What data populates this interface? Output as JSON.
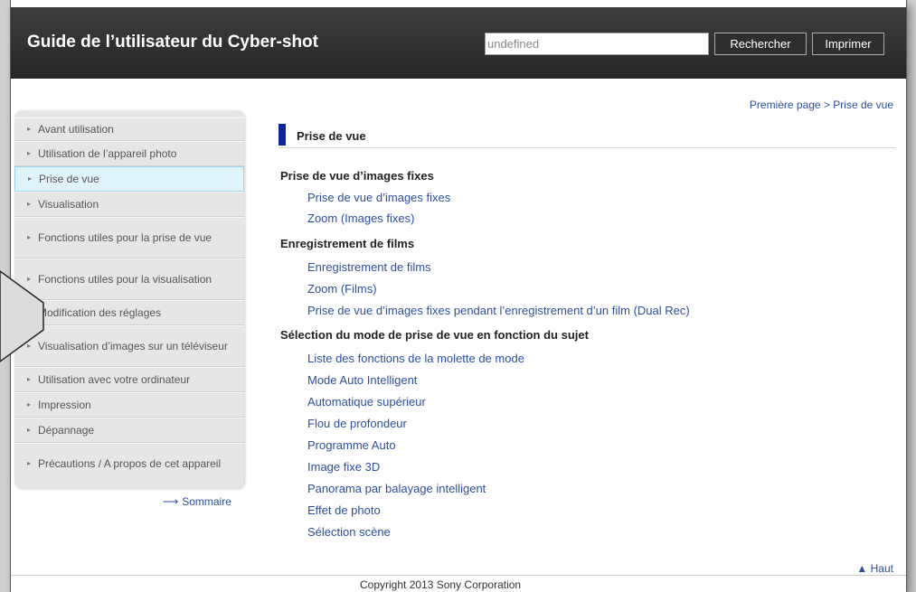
{
  "header": {
    "title": "Guide de l’utilisateur du Cyber-shot",
    "search_value": "undefined",
    "search_button": "Rechercher",
    "print_button": "Imprimer"
  },
  "breadcrumb": {
    "home": "Première page",
    "separator": " > ",
    "current": "Prise de vue"
  },
  "sidebar": {
    "items": [
      {
        "label": "Avant utilisation"
      },
      {
        "label": "Utilisation de l’appareil photo"
      },
      {
        "label": "Prise de vue",
        "active": true
      },
      {
        "label": "Visualisation"
      },
      {
        "label": "Fonctions utiles pour la prise de vue"
      },
      {
        "label": "Fonctions utiles pour la visualisation"
      },
      {
        "label": "Modification des réglages"
      },
      {
        "label": "Visualisation d’images sur un téléviseur"
      },
      {
        "label": "Utilisation avec votre ordinateur"
      },
      {
        "label": "Impression"
      },
      {
        "label": "Dépannage"
      },
      {
        "label": "Précautions / A propos de cet appareil"
      }
    ],
    "sommaire": "Sommaire"
  },
  "main": {
    "section_title": "Prise de vue",
    "groups": [
      {
        "title": "Prise de vue d’images fixes",
        "links": [
          "Prise de vue d’images fixes",
          "Zoom (Images fixes)"
        ]
      },
      {
        "title": "Enregistrement de films",
        "links": [
          "Enregistrement de films",
          "Zoom (Films)",
          "Prise de vue d’images fixes pendant l’enregistrement d’un film (Dual Rec)"
        ]
      },
      {
        "title": "Sélection du mode de prise de vue en fonction du sujet",
        "links": [
          "Liste des fonctions de la molette de mode",
          "Mode Auto Intelligent",
          "Automatique supérieur",
          "Flou de profondeur",
          "Programme Auto",
          "Image fixe 3D",
          "Panorama par balayage intelligent",
          "Effet de photo",
          "Sélection scène"
        ]
      }
    ],
    "top_link": "Haut"
  },
  "footer": {
    "copyright": "Copyright 2013 Sony Corporation"
  },
  "colors": {
    "header_bg": "#2e2e2e",
    "link": "#2e4f9e",
    "section_bar": "#10249a",
    "active_item_bg": "#dff3fb"
  }
}
